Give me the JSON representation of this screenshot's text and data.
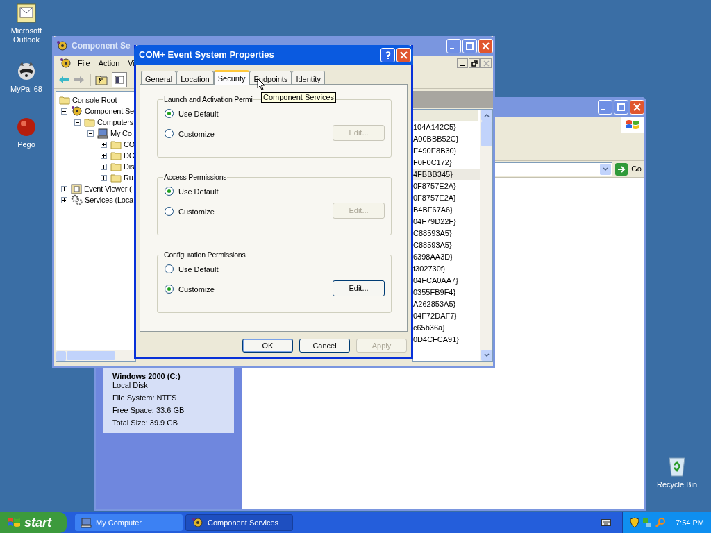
{
  "desktop_icons": [
    {
      "label": "Microsoft Outlook",
      "kind": "outlook"
    },
    {
      "label": "MyPal 68",
      "kind": "mypal"
    },
    {
      "label": "Pego",
      "kind": "pego"
    },
    {
      "label": "Recycle Bin",
      "kind": "recycle"
    }
  ],
  "my_computer_window": {
    "address_button": "Go",
    "details": {
      "title": "Windows 2000 (C:)",
      "lines": [
        "Local Disk",
        "File System: NTFS",
        "Free Space: 33.6 GB",
        "Total Size: 39.9 GB"
      ]
    }
  },
  "component_services_window": {
    "title": "Component Se",
    "menu": [
      "File",
      "Action",
      "Vi"
    ],
    "tree": [
      {
        "label": "Console Root",
        "kind": "folder",
        "children": [
          {
            "label": "Component Se",
            "kind": "services",
            "expanded": true,
            "children": [
              {
                "label": "Computers",
                "kind": "folder",
                "expanded": true,
                "children": [
                  {
                    "label": "My Co",
                    "kind": "computer",
                    "expanded": true,
                    "children": [
                      {
                        "label": "CO",
                        "kind": "folder",
                        "expanded": false
                      },
                      {
                        "label": "DC",
                        "kind": "folder",
                        "expanded": false
                      },
                      {
                        "label": "Dis",
                        "kind": "folder",
                        "expanded": false
                      },
                      {
                        "label": "Ru",
                        "kind": "folder",
                        "expanded": false
                      }
                    ]
                  }
                ]
              }
            ]
          },
          {
            "label": "Event Viewer (",
            "kind": "eventlog",
            "expanded": false
          },
          {
            "label": "Services (Loca",
            "kind": "gear",
            "expanded": false
          }
        ]
      }
    ],
    "list_rows": [
      {
        "text": "104A142C5}",
        "selected": false
      },
      {
        "text": "A00BBB52C}",
        "selected": false
      },
      {
        "text": "E490E8B30}",
        "selected": false
      },
      {
        "text": "F0F0C172}",
        "selected": false
      },
      {
        "text": "4FBBB345}",
        "selected": true
      },
      {
        "text": "0F8757E2A}",
        "selected": false
      },
      {
        "text": "0F8757E2A}",
        "selected": false
      },
      {
        "text": "B4BF67A6}",
        "selected": false
      },
      {
        "text": "04F79D22F}",
        "selected": false
      },
      {
        "text": "C88593A5}",
        "selected": false
      },
      {
        "text": "C88593A5}",
        "selected": false
      },
      {
        "text": "6398AA3D}",
        "selected": false
      },
      {
        "text": "f302730f}",
        "selected": false
      },
      {
        "text": "04FCA0AA7}",
        "selected": false
      },
      {
        "text": "0355FB9F4}",
        "selected": false
      },
      {
        "text": "A262853A5}",
        "selected": false
      },
      {
        "text": "04F72DAF7}",
        "selected": false
      },
      {
        "text": "c65b36a}",
        "selected": false
      },
      {
        "text": "0D4CFCA91}",
        "selected": false
      }
    ]
  },
  "dialog": {
    "title": "COM+ Event System Properties",
    "tabs": [
      {
        "label": "General",
        "selected": false
      },
      {
        "label": "Location",
        "selected": false
      },
      {
        "label": "Security",
        "selected": true
      },
      {
        "label": "Endpoints",
        "selected": false
      },
      {
        "label": "Identity",
        "selected": false
      }
    ],
    "groups": [
      {
        "title": "Launch and Activation Permi",
        "options": [
          {
            "label": "Use Default",
            "selected": true
          },
          {
            "label": "Customize",
            "selected": false
          }
        ],
        "edit_button": {
          "label": "Edit...",
          "disabled": true
        }
      },
      {
        "title": "Access Permissions",
        "options": [
          {
            "label": "Use Default",
            "selected": true
          },
          {
            "label": "Customize",
            "selected": false
          }
        ],
        "edit_button": {
          "label": "Edit...",
          "disabled": true
        }
      },
      {
        "title": "Configuration Permissions",
        "options": [
          {
            "label": "Use Default",
            "selected": false
          },
          {
            "label": "Customize",
            "selected": true
          }
        ],
        "edit_button": {
          "label": "Edit...",
          "disabled": false
        }
      }
    ],
    "buttons": [
      {
        "label": "OK",
        "disabled": false
      },
      {
        "label": "Cancel",
        "disabled": false
      },
      {
        "label": "Apply",
        "disabled": true
      }
    ]
  },
  "tooltip": "Component Services",
  "taskbar": {
    "start": "start",
    "tasks": [
      {
        "label": "My Computer",
        "kind": "computer",
        "selected": false
      },
      {
        "label": "Component Services",
        "kind": "services",
        "selected": true
      }
    ],
    "clock": "7:54 PM"
  }
}
